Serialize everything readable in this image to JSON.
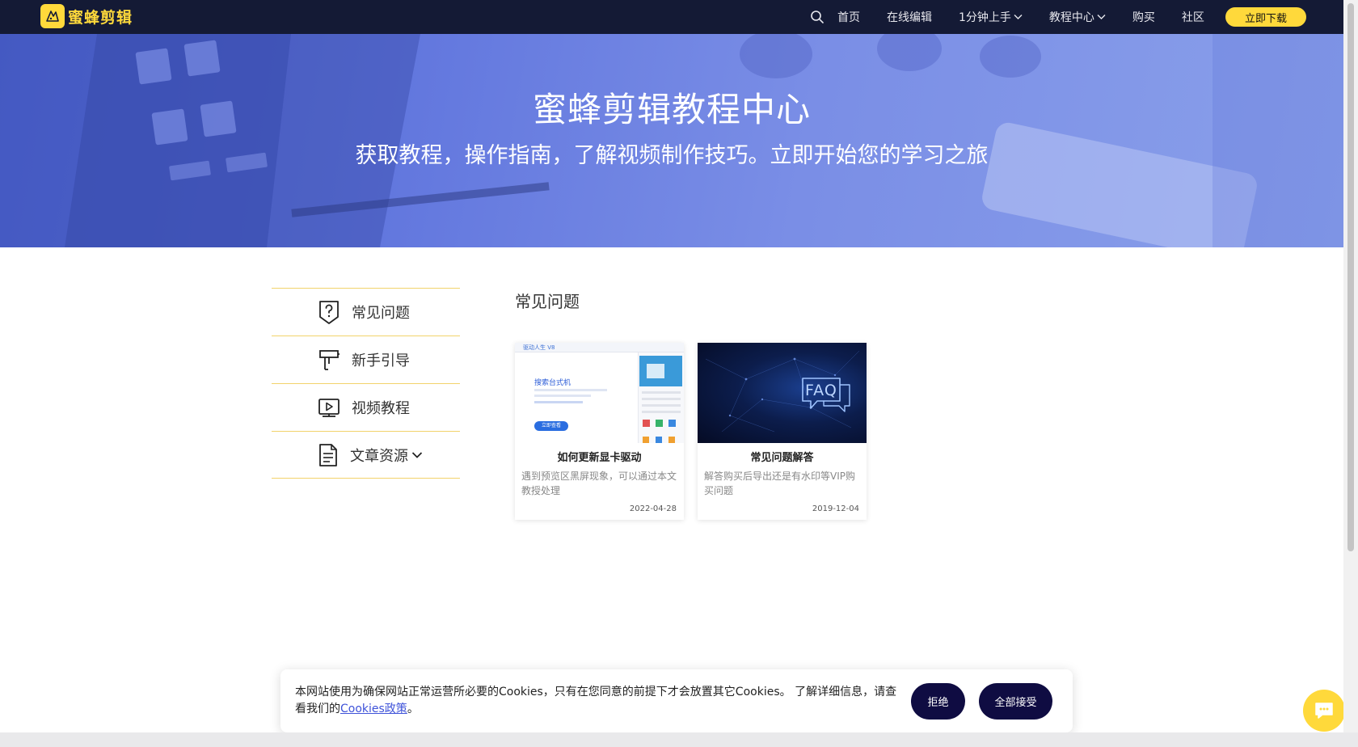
{
  "header": {
    "logo_text": "蜜蜂剪辑",
    "nav": [
      {
        "label": "首页"
      },
      {
        "label": "在线编辑"
      },
      {
        "label": "1分钟上手"
      },
      {
        "label": "教程中心"
      },
      {
        "label": "购买"
      },
      {
        "label": "社区"
      }
    ],
    "download_label": "立即下载"
  },
  "hero": {
    "title": "蜜蜂剪辑教程中心",
    "subtitle": "获取教程，操作指南，了解视频制作技巧。立即开始您的学习之旅"
  },
  "sidebar": {
    "items": [
      {
        "label": "常见问题",
        "icon": "question-shield-icon"
      },
      {
        "label": "新手引导",
        "icon": "signpost-icon"
      },
      {
        "label": "视频教程",
        "icon": "video-play-icon"
      },
      {
        "label": "文章资源",
        "icon": "document-icon"
      }
    ]
  },
  "main": {
    "section_title": "常见问题",
    "cards": [
      {
        "title": "如何更新显卡驱动",
        "desc": "遇到预览区黑屏现象，可以通过本文教授处理",
        "date": "2022-04-28",
        "thumb_window_title": "驱动人生 V8",
        "thumb_heading": "搜索台式机",
        "thumb_button": "立即查看"
      },
      {
        "title": "常见问题解答",
        "desc": "解答购买后导出还是有水印等VIP购买问题",
        "date": "2019-12-04",
        "thumb_badge": "FAQ"
      }
    ]
  },
  "cookie": {
    "text_before": "本网站使用为确保网站正常运营所必要的Cookies，只有在您同意的前提下才会放置其它Cookies。 了解详细信息，请查看我们的",
    "link": "Cookies政策",
    "text_after": "。",
    "reject_label": "拒绝",
    "accept_label": "全部接受"
  },
  "colors": {
    "header_bg": "#141a35",
    "brand_yellow": "#ffd93b",
    "hero_blue": "#6277de",
    "divider_gold": "#f2d36b",
    "cookie_button": "#0f0c42"
  }
}
